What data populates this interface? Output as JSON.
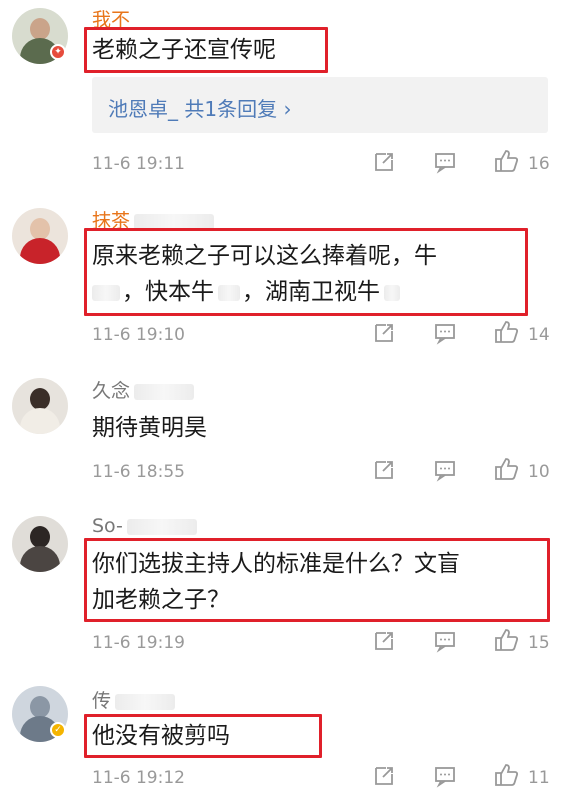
{
  "comments": [
    {
      "username": "我不",
      "text_lines": [
        "老赖之子还宣传呢"
      ],
      "reply": "池恩卓_  共1条回复 ›",
      "time": "11-6 19:11",
      "likes": "16"
    },
    {
      "username": "抹茶",
      "text_lines": [
        "原来老赖之子可以这么捧着呢，牛",
        "，快本牛",
        "，湖南卫视牛"
      ],
      "time": "11-6 19:10",
      "likes": "14"
    },
    {
      "username": "久念",
      "text_lines": [
        "期待黄明昊"
      ],
      "time": "11-6 18:55",
      "likes": "10"
    },
    {
      "username": "So-",
      "text_lines": [
        "你们选拔主持人的标准是什么？文盲",
        "加老赖之子？"
      ],
      "time": "11-6 19:19",
      "likes": "15"
    },
    {
      "username": "传",
      "text_lines": [
        "他没有被剪吗"
      ],
      "time": "11-6 19:12",
      "likes": "11"
    }
  ],
  "colors": {
    "highlight": "#e0202a",
    "username_accent": "#e8751a",
    "link": "#4f7bb8",
    "meta": "#999999"
  },
  "icons": [
    "share-icon",
    "comment-icon",
    "like-icon"
  ]
}
